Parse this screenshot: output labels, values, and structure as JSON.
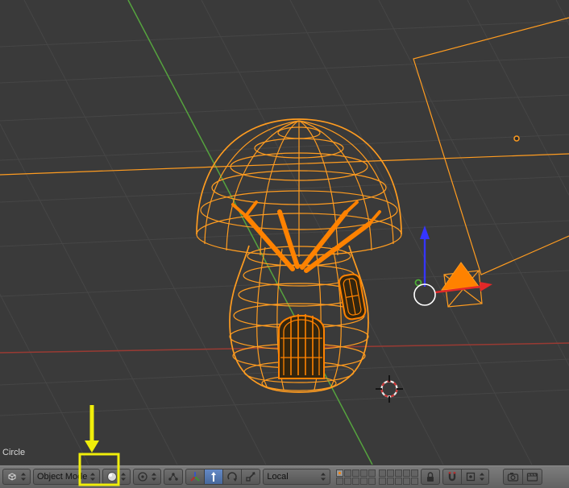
{
  "colors": {
    "viewport_bg": "#3a3a3a",
    "grid_line": "#464646",
    "wire_orange": "#ff9c20",
    "wire_orange_bright": "#ff8200",
    "axis_green": "#55a33e",
    "axis_red": "#993a33",
    "gizmo_blue": "#3535ff",
    "gizmo_red": "#e22828",
    "gizmo_green": "#4cae35",
    "cursor_red": "#cc3333",
    "annotation_yellow": "#f0ee0a",
    "overlay_text": "#d9d9d9"
  },
  "viewport": {
    "active_object_label": "Circle"
  },
  "header": {
    "editor_type_button": {
      "icon": "3d-viewport-editor-icon"
    },
    "mode_dropdown": {
      "value": "Object Mode"
    },
    "shading_dropdown": {
      "icon": "viewport-shading-sphere-icon",
      "highlighted": true
    },
    "pivot_dropdown": {
      "icon": "pivot-point-icon"
    },
    "center_points_toggle": {
      "icon": "manipulate-center-points-icon"
    },
    "manipulator_buttons": [
      {
        "name": "manipulator-axis",
        "active": false
      },
      {
        "name": "manipulator-translate",
        "active": true
      },
      {
        "name": "manipulator-rotate",
        "active": false
      },
      {
        "name": "manipulator-scale",
        "active": false
      }
    ],
    "orientation_dropdown": {
      "value": "Local"
    },
    "layers": {
      "total": 20,
      "active_index": 0
    },
    "lock_button": {
      "icon": "lock-icon"
    },
    "snap_toggle": {
      "icon": "magnet-icon"
    },
    "snap_target_dropdown": {
      "icon": "snap-target-icon"
    },
    "render_buttons": [
      {
        "icon": "render-still-icon"
      },
      {
        "icon": "render-anim-icon"
      }
    ]
  },
  "annotation": {
    "type": "arrow-and-box",
    "target": "shading-dropdown"
  }
}
